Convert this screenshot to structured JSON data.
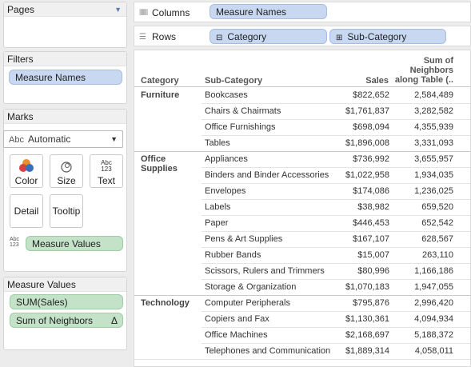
{
  "pages": {
    "title": "Pages"
  },
  "filters": {
    "title": "Filters",
    "pill": "Measure Names"
  },
  "marks": {
    "title": "Marks",
    "type_icon": "Abc",
    "type": "Automatic",
    "buttons": {
      "color": "Color",
      "size": "Size",
      "text": "Text",
      "detail": "Detail",
      "tooltip": "Tooltip"
    },
    "text_icon": "Abc 123",
    "measure_values_pill": "Measure Values"
  },
  "measure_values_card": {
    "title": "Measure Values",
    "pills": [
      "SUM(Sales)",
      "Sum of Neighbors"
    ],
    "delta_icon": "Δ"
  },
  "columns_shelf": {
    "label": "Columns",
    "pill": "Measure Names"
  },
  "rows_shelf": {
    "label": "Rows",
    "pills": [
      "Category",
      "Sub-Category"
    ]
  },
  "table": {
    "headers": {
      "category": "Category",
      "subcategory": "Sub-Category",
      "sales": "Sales",
      "neighbors": "Sum of Neighbors along Table (.."
    },
    "groups": [
      {
        "category": "Furniture",
        "rows": [
          {
            "sub": "Bookcases",
            "sales": "$822,652",
            "neighbors": "2,584,489"
          },
          {
            "sub": "Chairs & Chairmats",
            "sales": "$1,761,837",
            "neighbors": "3,282,582"
          },
          {
            "sub": "Office Furnishings",
            "sales": "$698,094",
            "neighbors": "4,355,939"
          },
          {
            "sub": "Tables",
            "sales": "$1,896,008",
            "neighbors": "3,331,093"
          }
        ]
      },
      {
        "category": "Office Supplies",
        "rows": [
          {
            "sub": "Appliances",
            "sales": "$736,992",
            "neighbors": "3,655,957"
          },
          {
            "sub": "Binders and Binder Accessories",
            "sales": "$1,022,958",
            "neighbors": "1,934,035"
          },
          {
            "sub": "Envelopes",
            "sales": "$174,086",
            "neighbors": "1,236,025"
          },
          {
            "sub": "Labels",
            "sales": "$38,982",
            "neighbors": "659,520"
          },
          {
            "sub": "Paper",
            "sales": "$446,453",
            "neighbors": "652,542"
          },
          {
            "sub": "Pens & Art Supplies",
            "sales": "$167,107",
            "neighbors": "628,567"
          },
          {
            "sub": "Rubber Bands",
            "sales": "$15,007",
            "neighbors": "263,110"
          },
          {
            "sub": "Scissors, Rulers and Trimmers",
            "sales": "$80,996",
            "neighbors": "1,166,186"
          },
          {
            "sub": "Storage & Organization",
            "sales": "$1,070,183",
            "neighbors": "1,947,055"
          }
        ]
      },
      {
        "category": "Technology",
        "rows": [
          {
            "sub": "Computer Peripherals",
            "sales": "$795,876",
            "neighbors": "2,996,420"
          },
          {
            "sub": "Copiers and Fax",
            "sales": "$1,130,361",
            "neighbors": "4,094,934"
          },
          {
            "sub": "Office Machines",
            "sales": "$2,168,697",
            "neighbors": "5,188,372"
          },
          {
            "sub": "Telephones and Communication",
            "sales": "$1,889,314",
            "neighbors": "4,058,011"
          }
        ]
      }
    ]
  }
}
